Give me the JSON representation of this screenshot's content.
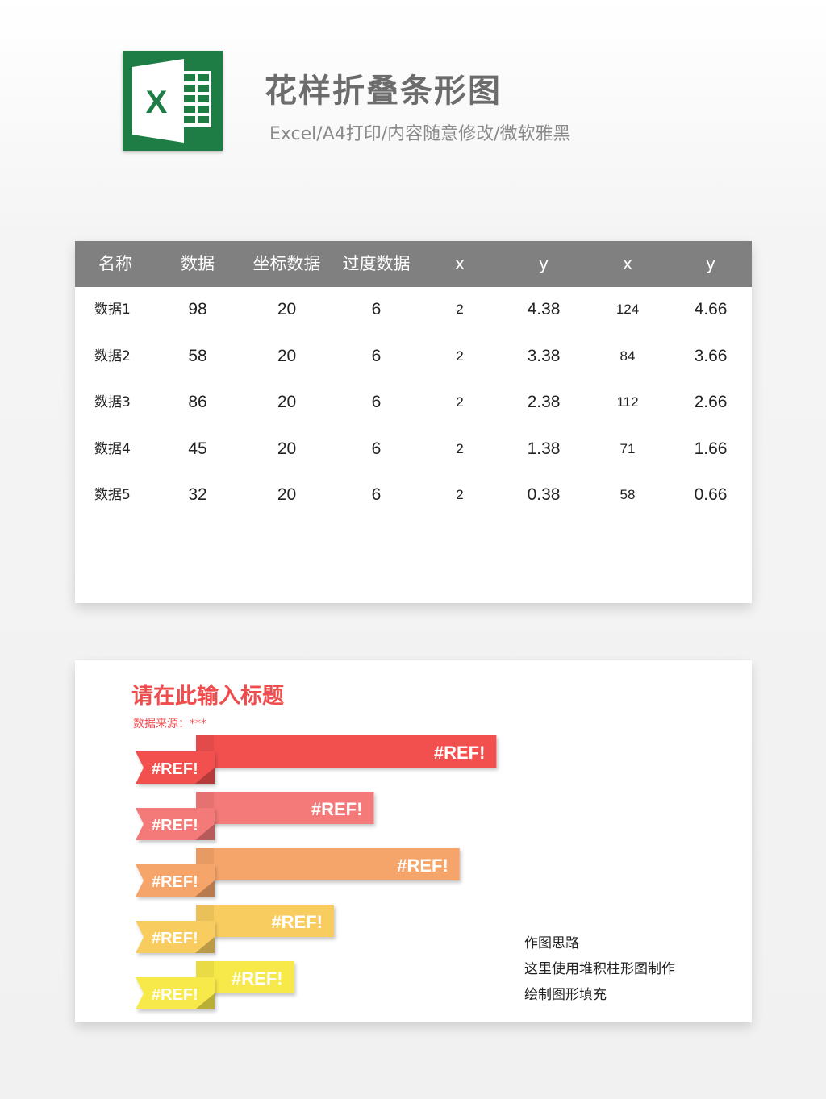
{
  "header": {
    "logo_letter": "X",
    "title": "花样折叠条形图",
    "subtitle": "Excel/A4打印/内容随意修改/微软雅黑"
  },
  "table": {
    "columns": [
      "名称",
      "数据",
      "坐标数据",
      "过度数据",
      "x",
      "y",
      "x",
      "y"
    ],
    "rows": [
      [
        "数据1",
        "98",
        "20",
        "6",
        "2",
        "4.38",
        "124",
        "4.66"
      ],
      [
        "数据2",
        "58",
        "20",
        "6",
        "2",
        "3.38",
        "84",
        "3.66"
      ],
      [
        "数据3",
        "86",
        "20",
        "6",
        "2",
        "2.38",
        "112",
        "2.66"
      ],
      [
        "数据4",
        "45",
        "20",
        "6",
        "2",
        "1.38",
        "71",
        "1.66"
      ],
      [
        "数据5",
        "32",
        "20",
        "6",
        "2",
        "0.38",
        "58",
        "0.66"
      ]
    ]
  },
  "chart": {
    "title": "请在此输入标题",
    "source": "数据来源：***",
    "notes": [
      "作图思路",
      "这里使用堆积柱形图制作",
      "绘制图形填充"
    ]
  },
  "chart_data": {
    "type": "bar",
    "categories": [
      "数据1",
      "数据2",
      "数据3",
      "数据4",
      "数据5"
    ],
    "values": [
      98,
      58,
      86,
      45,
      32
    ],
    "labels": [
      "#REF!",
      "#REF!",
      "#REF!",
      "#REF!",
      "#REF!"
    ],
    "tab_labels": [
      "#REF!",
      "#REF!",
      "#REF!",
      "#REF!",
      "#REF!"
    ],
    "colors": [
      "#f2504f",
      "#f47a79",
      "#f6a56a",
      "#f9cc5e",
      "#f7e94a"
    ],
    "tab_colors": [
      "#f2504f",
      "#f47a79",
      "#f6a56a",
      "#f9cc5e",
      "#f7e94a"
    ]
  }
}
